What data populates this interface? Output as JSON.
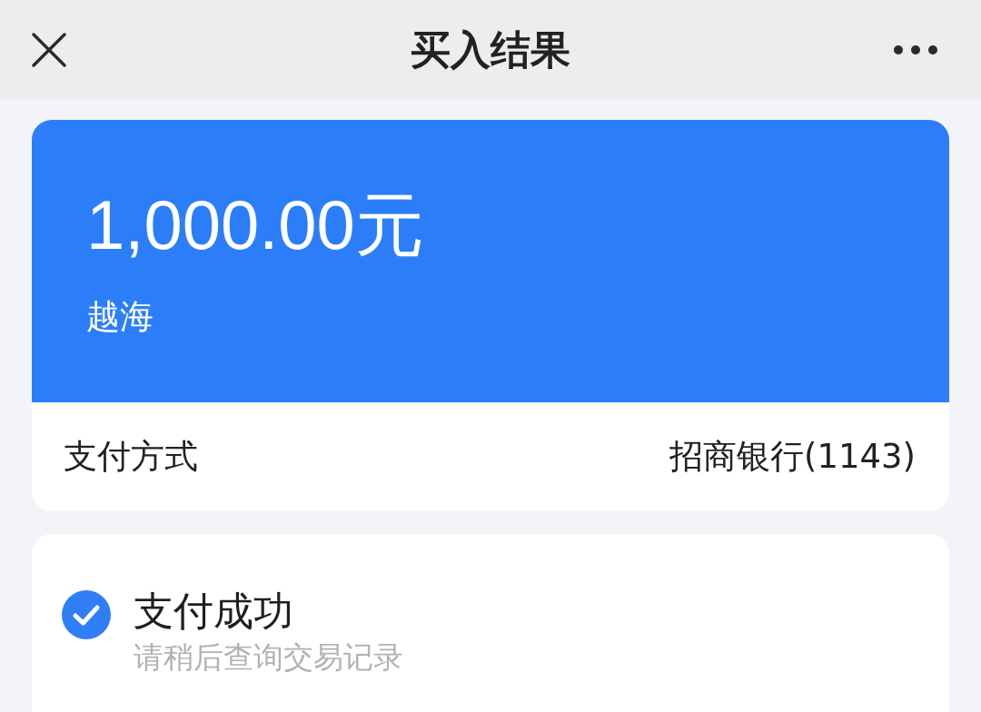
{
  "nav_bar": {
    "title": "买入结果"
  },
  "order_card": {
    "amount": "1,000.00元",
    "fund_name": "越海",
    "payment_method": {
      "label": "支付方式",
      "value": "招商银行(1143)"
    }
  },
  "status_card": {
    "title": "支付成功",
    "subtitle": "请稍后查询交易记录"
  }
}
